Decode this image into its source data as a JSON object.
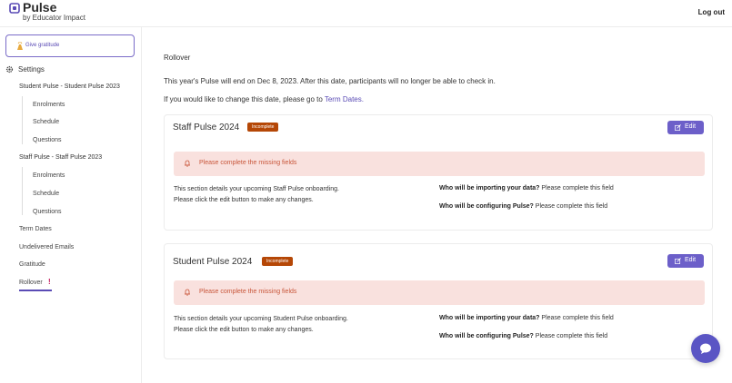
{
  "header": {
    "app_title": "Pulse",
    "subtitle": "by Educator Impact",
    "logout_label": "Log out",
    "brand_color": "#5a4bb5",
    "logo_icon": "pulse-logo-icon"
  },
  "sidebar": {
    "give_gratitude_label": "Give gratitude",
    "give_gratitude_icon": "clapping-hands-icon",
    "settings_label": "Settings",
    "settings_icon": "gear-icon",
    "groups": [
      {
        "label": "Student Pulse - Student Pulse 2023",
        "items": [
          "Enrolments",
          "Schedule",
          "Questions"
        ]
      },
      {
        "label": "Staff Pulse - Staff Pulse 2023",
        "items": [
          "Enrolments",
          "Schedule",
          "Questions"
        ]
      }
    ],
    "links": [
      "Term Dates",
      "Undelivered Emails",
      "Gratitude"
    ],
    "rollover_label": "Rollover",
    "rollover_alert": "!",
    "active_item": "Rollover"
  },
  "main": {
    "heading": "Rollover",
    "info_line_1": "This year's Pulse will end on Dec 8, 2023. After this date, participants will no longer be able to check in.",
    "info_line_2_prefix": "If you would like to change this date, please go to",
    "info_line_2_link": "Term Dates.",
    "cards": [
      {
        "title": "Staff Pulse 2024",
        "badge": "Incomplete",
        "edit_label": "Edit",
        "alert_text": "Please complete the missing fields",
        "desc_line_1": "This section details your upcoming Staff Pulse onboarding.",
        "desc_line_2": "Please click the edit button to make any changes.",
        "fields": [
          {
            "question": "Who will be importing your data?",
            "answer": "Please complete this field"
          },
          {
            "question": "Who will be configuring Pulse?",
            "answer": "Please complete this field"
          }
        ]
      },
      {
        "title": "Student Pulse 2024",
        "badge": "Incomplete",
        "edit_label": "Edit",
        "alert_text": "Please complete the missing fields",
        "desc_line_1": "This section details your upcoming Student Pulse onboarding.",
        "desc_line_2": "Please click the edit button to make any changes.",
        "fields": [
          {
            "question": "Who will be importing your data?",
            "answer": "Please complete this field"
          },
          {
            "question": "Who will be configuring Pulse?",
            "answer": "Please complete this field"
          }
        ]
      }
    ],
    "badge_color": "#b54706",
    "alert_bg": "#f9e1de",
    "alert_text_color": "#c8563a",
    "edit_button_color": "#6c5fc9"
  },
  "chat": {
    "icon": "chat-bubble-icon",
    "color": "#5a55c4"
  }
}
